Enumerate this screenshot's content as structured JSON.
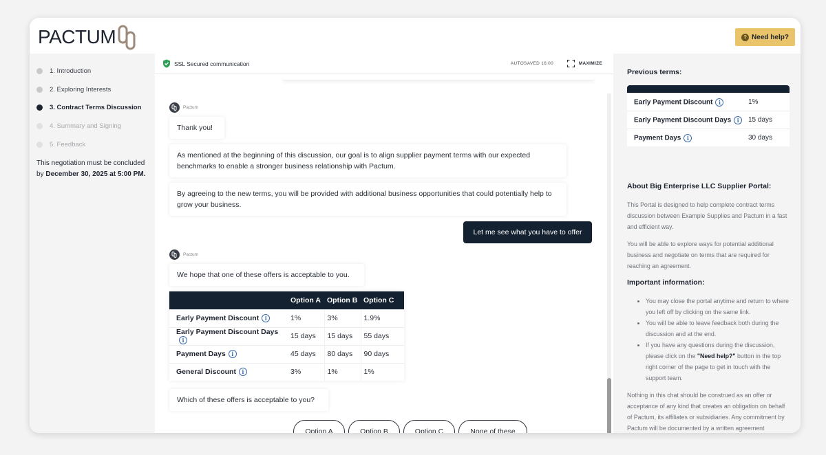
{
  "brand": {
    "name": "PACTUM"
  },
  "header": {
    "help_label": "Need help?"
  },
  "steps": [
    {
      "label": "1. Introduction",
      "state": "done"
    },
    {
      "label": "2. Exploring Interests",
      "state": "done"
    },
    {
      "label": "3. Contract Terms Discussion",
      "state": "active"
    },
    {
      "label": "4. Summary and Signing",
      "state": "future"
    },
    {
      "label": "5. Feedback",
      "state": "future"
    }
  ],
  "deadline": {
    "prefix": "This negotiation must be concluded by ",
    "date": "December 30, 2025 at 5:00 PM."
  },
  "chat": {
    "ssl_label": "SSL Secured communication",
    "autosaved": "AUTOSAVED 16:00",
    "maximize": "MAXIMIZE",
    "sender": "Pactum",
    "messages": [
      "Thank you!",
      "As mentioned at the beginning of this discussion, our goal is to align supplier payment terms with our expected benchmarks to enable a stronger business relationship with Pactum.",
      "By agreeing to the new terms, you will be provided with additional business opportunities that could potentially help to grow your business.",
      "We hope that one of these offers is acceptable to you.",
      "Which of these offers is acceptable to you?"
    ],
    "user_message": "Let me see what you have to offer",
    "table": {
      "headers": [
        "",
        "Option A",
        "Option B",
        "Option C"
      ],
      "rows": [
        {
          "label": "Early Payment Discount",
          "values": [
            "1%",
            "3%",
            "1.9%"
          ]
        },
        {
          "label": "Early Payment Discount Days",
          "values": [
            "15 days",
            "15 days",
            "55 days"
          ]
        },
        {
          "label": "Payment Days",
          "values": [
            "45 days",
            "80 days",
            "90 days"
          ]
        },
        {
          "label": "General Discount",
          "values": [
            "3%",
            "1%",
            "1%"
          ]
        }
      ]
    },
    "choices": [
      "Option A",
      "Option B",
      "Option C",
      "None of these"
    ]
  },
  "right": {
    "previous_title": "Previous terms:",
    "previous_terms": [
      {
        "label": "Early Payment Discount",
        "value": "1%"
      },
      {
        "label": "Early Payment Discount Days",
        "value": "15 days"
      },
      {
        "label": "Payment Days",
        "value": "30 days"
      }
    ],
    "about_title": "About Big Enterprise LLC Supplier Portal:",
    "about_p1": "This Portal is designed to help complete contract terms discussion between Example Supplies and Pactum in a fast and efficient way.",
    "about_p2": "You will be able to explore ways for potential additional business and negotiate on terms that are required for reaching an agreement.",
    "important_title": "Important information:",
    "bullets": [
      "You may close the portal anytime and return to where you left off by clicking on the same link.",
      "You will be able to leave feedback both during the discussion and at the end."
    ],
    "bullet3_pre": "If you have any questions during the discussion, please click on the ",
    "bullet3_bold": "\"Need help?\"",
    "bullet3_post": " button in the top right corner of the page to get in touch with the support team.",
    "disclaimer": "Nothing in this chat should be construed as an offer or acceptance of any kind that creates an obligation on behalf of Pactum, its affiliates or subsidiaries. Any commitment by Pactum will be documented by a written agreement executed by an officer of the Company or a"
  }
}
